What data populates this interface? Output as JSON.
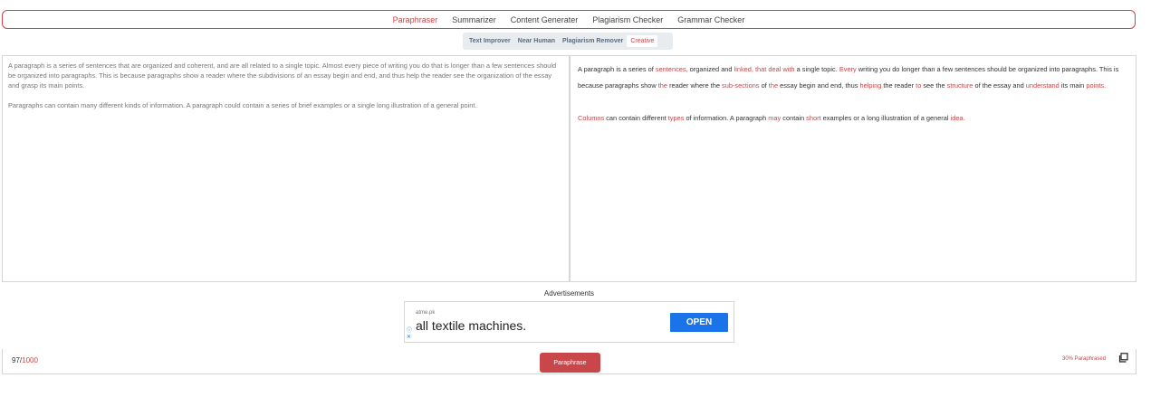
{
  "nav": {
    "items": [
      "Paraphraser",
      "Summarizer",
      "Content Generater",
      "Plagiarism Checker",
      "Grammar Checker"
    ],
    "active": "Paraphraser"
  },
  "modes": {
    "items": [
      "Text Improver",
      "Near Human",
      "Plagiarism Remover",
      "Creative"
    ],
    "active": "Creative"
  },
  "input": {
    "paragraph1": "A paragraph is a series of sentences that are organized and coherent, and are all related to a single topic. Almost every piece of writing you do that is longer than a few sentences should be organized into paragraphs. This is because paragraphs show a reader where the subdivisions of an essay begin and end, and thus help the reader see the organization of the essay and grasp its main points.",
    "paragraph2": "Paragraphs can contain many different kinds of information. A paragraph could contain a series of brief examples or a single long illustration of a general point."
  },
  "output": {
    "paragraphs": [
      [
        {
          "t": "A paragraph is a series of ",
          "c": false
        },
        {
          "t": "sentences,",
          "c": true
        },
        {
          "t": " organized and ",
          "c": false
        },
        {
          "t": "linked, that deal with",
          "c": true
        },
        {
          "t": " a single topic. ",
          "c": false
        },
        {
          "t": "Every",
          "c": true
        },
        {
          "t": " writing you do longer than a few sentences should be organized into paragraphs. This is because paragraphs show ",
          "c": false
        },
        {
          "t": "the",
          "c": true
        },
        {
          "t": " reader where the ",
          "c": false
        },
        {
          "t": "sub-sections",
          "c": true
        },
        {
          "t": " of ",
          "c": false
        },
        {
          "t": "the",
          "c": true
        },
        {
          "t": " essay begin and end, thus ",
          "c": false
        },
        {
          "t": "helping",
          "c": true
        },
        {
          "t": " the reader ",
          "c": false
        },
        {
          "t": "to",
          "c": true
        },
        {
          "t": " see the ",
          "c": false
        },
        {
          "t": "structure",
          "c": true
        },
        {
          "t": " of the essay and ",
          "c": false
        },
        {
          "t": "understand",
          "c": true
        },
        {
          "t": " its main ",
          "c": false
        },
        {
          "t": "points.",
          "c": true
        }
      ],
      [
        {
          "t": "Columns",
          "c": true
        },
        {
          "t": " can contain different ",
          "c": false
        },
        {
          "t": "types",
          "c": true
        },
        {
          "t": " of information. A paragraph ",
          "c": false
        },
        {
          "t": "may",
          "c": true
        },
        {
          "t": " contain ",
          "c": false
        },
        {
          "t": "short",
          "c": true
        },
        {
          "t": " examples or a long illustration of a general ",
          "c": false
        },
        {
          "t": "idea.",
          "c": true
        }
      ]
    ]
  },
  "ad": {
    "label": "Advertisements",
    "source": "atme.pk",
    "headline": "all textile machines.",
    "open_label": "OPEN"
  },
  "footer": {
    "word_count": "97/",
    "word_limit": "1000",
    "button_label": "Paraphrase",
    "percent_label": "30% Paraphrased"
  },
  "colors": {
    "accent": "#c9474a",
    "ad_button": "#1a73e8"
  }
}
